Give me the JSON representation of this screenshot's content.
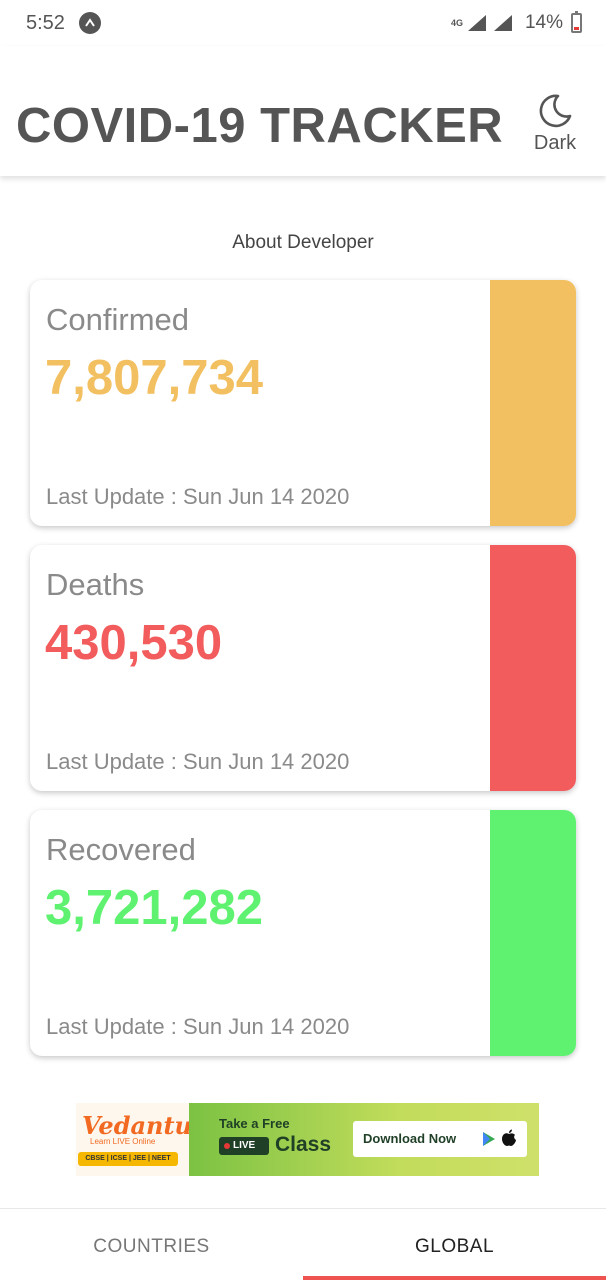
{
  "status_bar": {
    "time": "5:52",
    "network": "4G",
    "battery": "14%",
    "battery_level": 0.14
  },
  "header": {
    "title": "COVID-19 TRACKER",
    "theme_toggle_label": "Dark",
    "theme_icon": "moon-icon"
  },
  "about_link": "About Developer",
  "cards": [
    {
      "label": "Confirmed",
      "value": "7,807,734",
      "update": "Last Update : Sun Jun 14 2020",
      "color": "#f2c060"
    },
    {
      "label": "Deaths",
      "value": "430,530",
      "update": "Last Update : Sun Jun 14 2020",
      "color": "#f25c5c"
    },
    {
      "label": "Recovered",
      "value": "3,721,282",
      "update": "Last Update : Sun Jun 14 2020",
      "color": "#5ef270"
    }
  ],
  "ad": {
    "brand": "Vedantu",
    "tagline": "Learn LIVE Online",
    "tags": "CBSE | ICSE | JEE | NEET",
    "offer": "Take a Free",
    "live_badge": "LIVE",
    "class_label": "Class",
    "cta": "Download Now"
  },
  "tabs": {
    "countries": "COUNTRIES",
    "global": "GLOBAL",
    "active": "global"
  },
  "colors": {
    "accent": "#ef5350",
    "title": "#555555"
  }
}
